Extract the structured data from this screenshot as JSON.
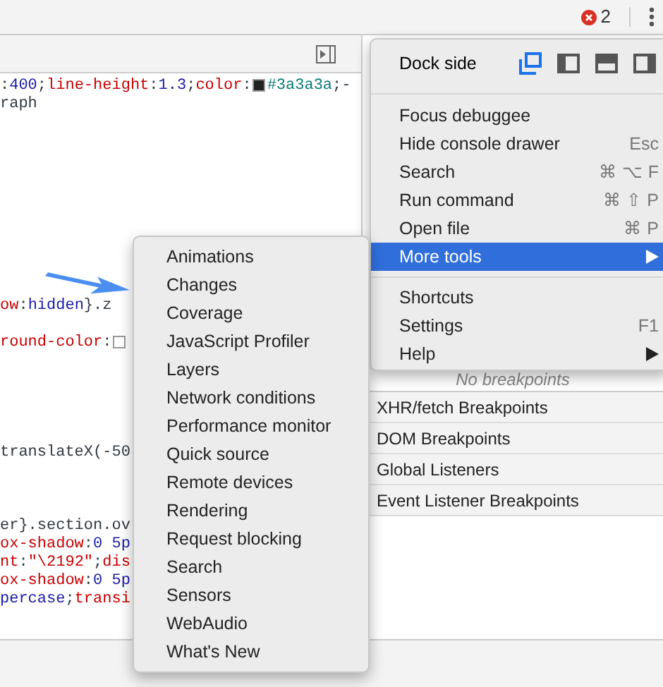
{
  "top_bar": {
    "error_count": "2"
  },
  "editor": {
    "lines": [
      {
        "tokens": [
          {
            "text": ":",
            "kind": "plain"
          },
          {
            "text": "400",
            "kind": "value"
          },
          {
            "text": ";",
            "kind": "plain"
          },
          {
            "text": "line-height",
            "kind": "prop"
          },
          {
            "text": ":",
            "kind": "plain"
          },
          {
            "text": "1.3",
            "kind": "value"
          },
          {
            "text": ";",
            "kind": "plain"
          },
          {
            "text": "color",
            "kind": "prop"
          },
          {
            "text": ":",
            "kind": "plain"
          },
          {
            "kind": "swatch",
            "color": "#222222"
          },
          {
            "text": "#3a3a3a",
            "kind": "hex"
          },
          {
            "text": ";-",
            "kind": "plain"
          }
        ]
      },
      {
        "tokens": [
          {
            "text": "raph",
            "kind": "plain"
          }
        ]
      },
      {
        "tokens": [
          {
            "text": "ow",
            "kind": "prop"
          },
          {
            "text": ":",
            "kind": "plain"
          },
          {
            "text": "hidden",
            "kind": "value"
          },
          {
            "text": "}.z",
            "kind": "plain"
          }
        ]
      },
      {
        "tokens": [
          {
            "text": "round-color",
            "kind": "prop"
          },
          {
            "text": ":",
            "kind": "plain"
          },
          {
            "kind": "swatch",
            "color": "#ffffff"
          }
        ]
      },
      {
        "tokens": [
          {
            "text": "translateX(-50",
            "kind": "plain"
          }
        ]
      },
      {
        "tokens": [
          {
            "text": "er}.section.ov",
            "kind": "plain"
          }
        ]
      },
      {
        "tokens": [
          {
            "text": "ox-shadow",
            "kind": "prop"
          },
          {
            "text": ":",
            "kind": "plain"
          },
          {
            "text": "0 5p",
            "kind": "value"
          }
        ]
      },
      {
        "tokens": [
          {
            "text": "nt",
            "kind": "prop"
          },
          {
            "text": ":",
            "kind": "plain"
          },
          {
            "text": "\"\\2192\"",
            "kind": "string"
          },
          {
            "text": ";",
            "kind": "plain"
          },
          {
            "text": "dis",
            "kind": "prop"
          }
        ]
      },
      {
        "tokens": [
          {
            "text": "ox-shadow",
            "kind": "prop"
          },
          {
            "text": ":",
            "kind": "plain"
          },
          {
            "text": "0 5p",
            "kind": "value"
          }
        ]
      },
      {
        "tokens": [
          {
            "text": "percase",
            "kind": "value"
          },
          {
            "text": ";",
            "kind": "plain"
          },
          {
            "text": "transi",
            "kind": "prop"
          }
        ]
      }
    ]
  },
  "sidebar": {
    "empty_note": "No breakpoints",
    "sections": [
      "XHR/fetch Breakpoints",
      "DOM Breakpoints",
      "Global Listeners",
      "Event Listener Breakpoints"
    ]
  },
  "main_menu": [
    {
      "kind": "dock",
      "label": "Dock side",
      "options": [
        {
          "selected": true
        },
        {
          "selected": false
        },
        {
          "selected": false
        },
        {
          "selected": false
        }
      ]
    },
    {
      "kind": "separator"
    },
    {
      "kind": "item",
      "label": "Focus debuggee",
      "selected": false,
      "submenu": false
    },
    {
      "kind": "item",
      "label": "Hide console drawer",
      "shortcut": "Esc",
      "selected": false,
      "submenu": false
    },
    {
      "kind": "item",
      "label": "Search",
      "shortcut": "⌘ ⌥ F",
      "selected": false,
      "submenu": false
    },
    {
      "kind": "item",
      "label": "Run command",
      "shortcut": "⌘ ⇧ P",
      "selected": false,
      "submenu": false
    },
    {
      "kind": "item",
      "label": "Open file",
      "shortcut": "⌘ P",
      "selected": false,
      "submenu": false
    },
    {
      "kind": "item",
      "label": "More tools",
      "selected": true,
      "submenu": true
    },
    {
      "kind": "separator"
    },
    {
      "kind": "item",
      "label": "Shortcuts",
      "selected": false,
      "submenu": false
    },
    {
      "kind": "item",
      "label": "Settings",
      "shortcut": "F1",
      "selected": false,
      "submenu": false
    },
    {
      "kind": "item",
      "label": "Help",
      "selected": false,
      "submenu": true
    }
  ],
  "more_tools_menu": [
    "Animations",
    "Changes",
    "Coverage",
    "JavaScript Profiler",
    "Layers",
    "Network conditions",
    "Performance monitor",
    "Quick source",
    "Remote devices",
    "Rendering",
    "Request blocking",
    "Search",
    "Sensors",
    "WebAudio",
    "What's New"
  ]
}
